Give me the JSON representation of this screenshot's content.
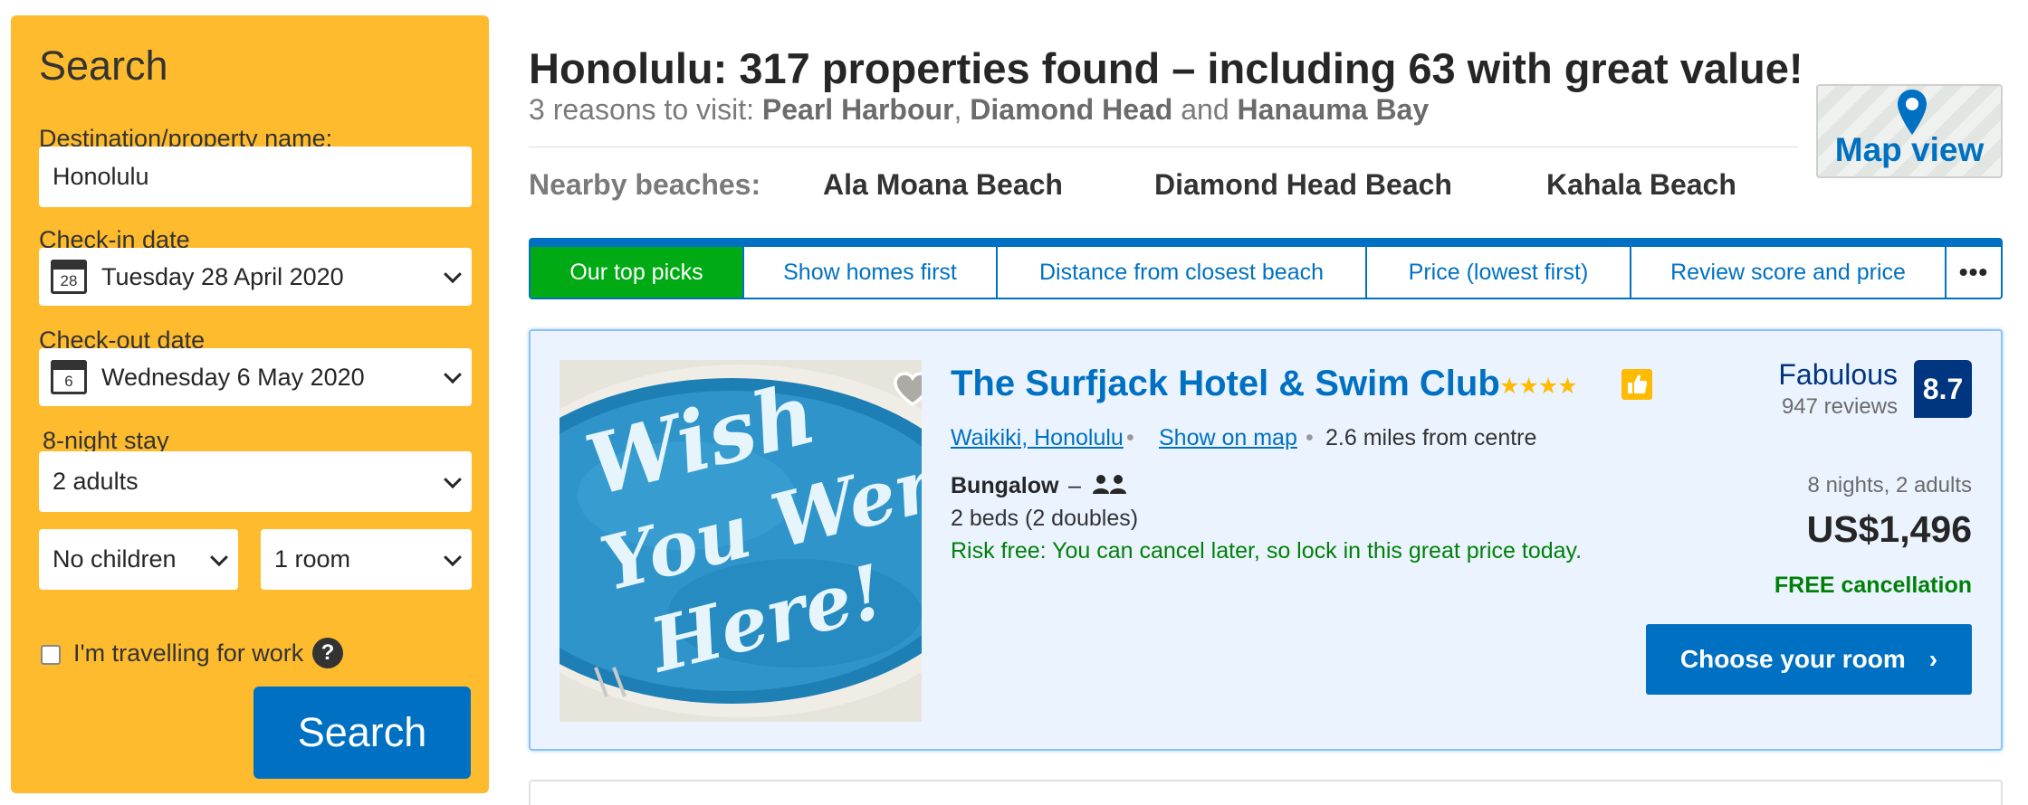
{
  "sidebar": {
    "title": "Search",
    "destination_label": "Destination/property name:",
    "destination_value": "Honolulu",
    "checkin_label": "Check-in date",
    "checkin_day": "28",
    "checkin_value": "Tuesday 28 April 2020",
    "checkout_label": "Check-out date",
    "checkout_day": "6",
    "checkout_value": "Wednesday 6 May 2020",
    "stay_length": "8-night stay",
    "adults": "2 adults",
    "children": "No children",
    "rooms": "1 room",
    "work_travel_label": "I'm travelling for work",
    "work_travel_checked": false,
    "help_glyph": "?",
    "search_button": "Search"
  },
  "header": {
    "title": "Honolulu: 317 properties found – including 63 with great value!",
    "reasons_prefix": "3 reasons to visit: ",
    "reasons": [
      "Pearl Harbour",
      "Diamond Head",
      "Hanauma Bay"
    ],
    "reasons_sep1": ", ",
    "reasons_sep2": " and ",
    "nearby_label": "Nearby beaches:",
    "beaches": [
      "Ala Moana Beach",
      "Diamond Head Beach",
      "Kahala Beach"
    ],
    "map_view": "Map view"
  },
  "sort_tabs": [
    {
      "label": "Our top picks",
      "active": true
    },
    {
      "label": "Show homes first",
      "active": false
    },
    {
      "label": "Distance from closest beach",
      "active": false
    },
    {
      "label": "Price (lowest first)",
      "active": false
    },
    {
      "label": "Review score and price",
      "active": false
    },
    {
      "label": "•••",
      "active": false
    }
  ],
  "property": {
    "name": "The Surfjack Hotel & Swim Club",
    "stars": "★★★★",
    "star_rating": 4,
    "area_link": "Waikiki, Honolulu",
    "map_link": "Show on map",
    "separator": "•",
    "distance": "2.6 miles from centre",
    "room_type": "Bungalow",
    "room_dash": "–",
    "beds": "2 beds (2 doubles)",
    "risk_free": "Risk free: You can cancel later, so lock in this great price today.",
    "review_word": "Fabulous",
    "review_count": "947 reviews",
    "score": "8.7",
    "stay_info": "8 nights, 2 adults",
    "price": "US$1,496",
    "free_cancellation": "FREE cancellation",
    "choose_button": "Choose your room",
    "choose_arrow": "›",
    "photo_text": [
      "Wish",
      "You Were",
      "Here!"
    ]
  },
  "colors": {
    "sidebar_bg": "#febb2d",
    "brand_blue": "#0071c2",
    "dark_blue": "#003580",
    "green": "#008009",
    "active_tab": "#00aa14",
    "card_bg": "#ebf3ff"
  }
}
